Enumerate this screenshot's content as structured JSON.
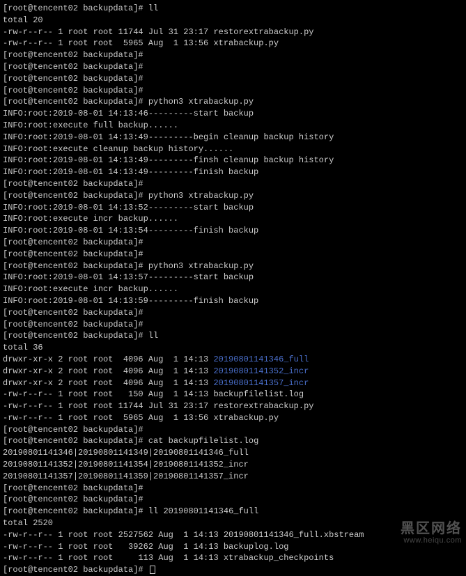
{
  "prompt": "[root@tencent02 backupdata]# ",
  "lines": [
    {
      "segs": [
        {
          "t": "prompt"
        },
        {
          "t": "text",
          "v": "ll"
        }
      ]
    },
    {
      "segs": [
        {
          "t": "text",
          "v": "total 20"
        }
      ]
    },
    {
      "segs": [
        {
          "t": "text",
          "v": "-rw-r--r-- 1 root root 11744 Jul 31 23:17 restorextrabackup.py"
        }
      ]
    },
    {
      "segs": [
        {
          "t": "text",
          "v": "-rw-r--r-- 1 root root  5965 Aug  1 13:56 xtrabackup.py"
        }
      ]
    },
    {
      "segs": [
        {
          "t": "prompt"
        }
      ]
    },
    {
      "segs": [
        {
          "t": "prompt"
        }
      ]
    },
    {
      "segs": [
        {
          "t": "prompt"
        }
      ]
    },
    {
      "segs": [
        {
          "t": "prompt"
        }
      ]
    },
    {
      "segs": [
        {
          "t": "prompt"
        },
        {
          "t": "text",
          "v": "python3 xtrabackup.py"
        }
      ]
    },
    {
      "segs": [
        {
          "t": "text",
          "v": "INFO:root:2019-08-01 14:13:46---------start backup"
        }
      ]
    },
    {
      "segs": [
        {
          "t": "text",
          "v": "INFO:root:execute full backup......"
        }
      ]
    },
    {
      "segs": [
        {
          "t": "text",
          "v": "INFO:root:2019-08-01 14:13:49---------begin cleanup backup history"
        }
      ]
    },
    {
      "segs": [
        {
          "t": "text",
          "v": "INFO:root:execute cleanup backup history......"
        }
      ]
    },
    {
      "segs": [
        {
          "t": "text",
          "v": "INFO:root:2019-08-01 14:13:49---------finsh cleanup backup history"
        }
      ]
    },
    {
      "segs": [
        {
          "t": "text",
          "v": "INFO:root:2019-08-01 14:13:49---------finish backup"
        }
      ]
    },
    {
      "segs": [
        {
          "t": "prompt"
        }
      ]
    },
    {
      "segs": [
        {
          "t": "prompt"
        },
        {
          "t": "text",
          "v": "python3 xtrabackup.py"
        }
      ]
    },
    {
      "segs": [
        {
          "t": "text",
          "v": "INFO:root:2019-08-01 14:13:52---------start backup"
        }
      ]
    },
    {
      "segs": [
        {
          "t": "text",
          "v": "INFO:root:execute incr backup......"
        }
      ]
    },
    {
      "segs": [
        {
          "t": "text",
          "v": "INFO:root:2019-08-01 14:13:54---------finish backup"
        }
      ]
    },
    {
      "segs": [
        {
          "t": "prompt"
        }
      ]
    },
    {
      "segs": [
        {
          "t": "prompt"
        }
      ]
    },
    {
      "segs": [
        {
          "t": "prompt"
        },
        {
          "t": "text",
          "v": "python3 xtrabackup.py"
        }
      ]
    },
    {
      "segs": [
        {
          "t": "text",
          "v": "INFO:root:2019-08-01 14:13:57---------start backup"
        }
      ]
    },
    {
      "segs": [
        {
          "t": "text",
          "v": "INFO:root:execute incr backup......"
        }
      ]
    },
    {
      "segs": [
        {
          "t": "text",
          "v": "INFO:root:2019-08-01 14:13:59---------finish backup"
        }
      ]
    },
    {
      "segs": [
        {
          "t": "prompt"
        }
      ]
    },
    {
      "segs": [
        {
          "t": "prompt"
        }
      ]
    },
    {
      "segs": [
        {
          "t": "prompt"
        },
        {
          "t": "text",
          "v": "ll"
        }
      ]
    },
    {
      "segs": [
        {
          "t": "text",
          "v": "total 36"
        }
      ]
    },
    {
      "segs": [
        {
          "t": "text",
          "v": "drwxr-xr-x 2 root root  4096 Aug  1 14:13 "
        },
        {
          "t": "dir",
          "v": "20190801141346_full"
        }
      ]
    },
    {
      "segs": [
        {
          "t": "text",
          "v": "drwxr-xr-x 2 root root  4096 Aug  1 14:13 "
        },
        {
          "t": "dir",
          "v": "20190801141352_incr"
        }
      ]
    },
    {
      "segs": [
        {
          "t": "text",
          "v": "drwxr-xr-x 2 root root  4096 Aug  1 14:13 "
        },
        {
          "t": "dir",
          "v": "20190801141357_incr"
        }
      ]
    },
    {
      "segs": [
        {
          "t": "text",
          "v": "-rw-r--r-- 1 root root   150 Aug  1 14:13 backupfilelist.log"
        }
      ]
    },
    {
      "segs": [
        {
          "t": "text",
          "v": "-rw-r--r-- 1 root root 11744 Jul 31 23:17 restorextrabackup.py"
        }
      ]
    },
    {
      "segs": [
        {
          "t": "text",
          "v": "-rw-r--r-- 1 root root  5965 Aug  1 13:56 xtrabackup.py"
        }
      ]
    },
    {
      "segs": [
        {
          "t": "prompt"
        }
      ]
    },
    {
      "segs": [
        {
          "t": "prompt"
        },
        {
          "t": "text",
          "v": "cat backupfilelist.log"
        }
      ]
    },
    {
      "segs": [
        {
          "t": "text",
          "v": "20190801141346|20190801141349|20190801141346_full"
        }
      ]
    },
    {
      "segs": [
        {
          "t": "text",
          "v": "20190801141352|20190801141354|20190801141352_incr"
        }
      ]
    },
    {
      "segs": [
        {
          "t": "text",
          "v": "20190801141357|20190801141359|20190801141357_incr"
        }
      ]
    },
    {
      "segs": [
        {
          "t": "prompt"
        }
      ]
    },
    {
      "segs": [
        {
          "t": "prompt"
        }
      ]
    },
    {
      "segs": [
        {
          "t": "prompt"
        },
        {
          "t": "text",
          "v": "ll 20190801141346_full"
        }
      ]
    },
    {
      "segs": [
        {
          "t": "text",
          "v": "total 2520"
        }
      ]
    },
    {
      "segs": [
        {
          "t": "text",
          "v": "-rw-r--r-- 1 root root 2527562 Aug  1 14:13 20190801141346_full.xbstream"
        }
      ]
    },
    {
      "segs": [
        {
          "t": "text",
          "v": "-rw-r--r-- 1 root root   39262 Aug  1 14:13 backuplog.log"
        }
      ]
    },
    {
      "segs": [
        {
          "t": "text",
          "v": "-rw-r--r-- 1 root root     113 Aug  1 14:13 xtrabackup_checkpoints"
        }
      ]
    },
    {
      "segs": [
        {
          "t": "prompt"
        },
        {
          "t": "cursor"
        }
      ]
    }
  ],
  "watermark": {
    "title": "黑区网络",
    "url": "www.heiqu.com"
  }
}
